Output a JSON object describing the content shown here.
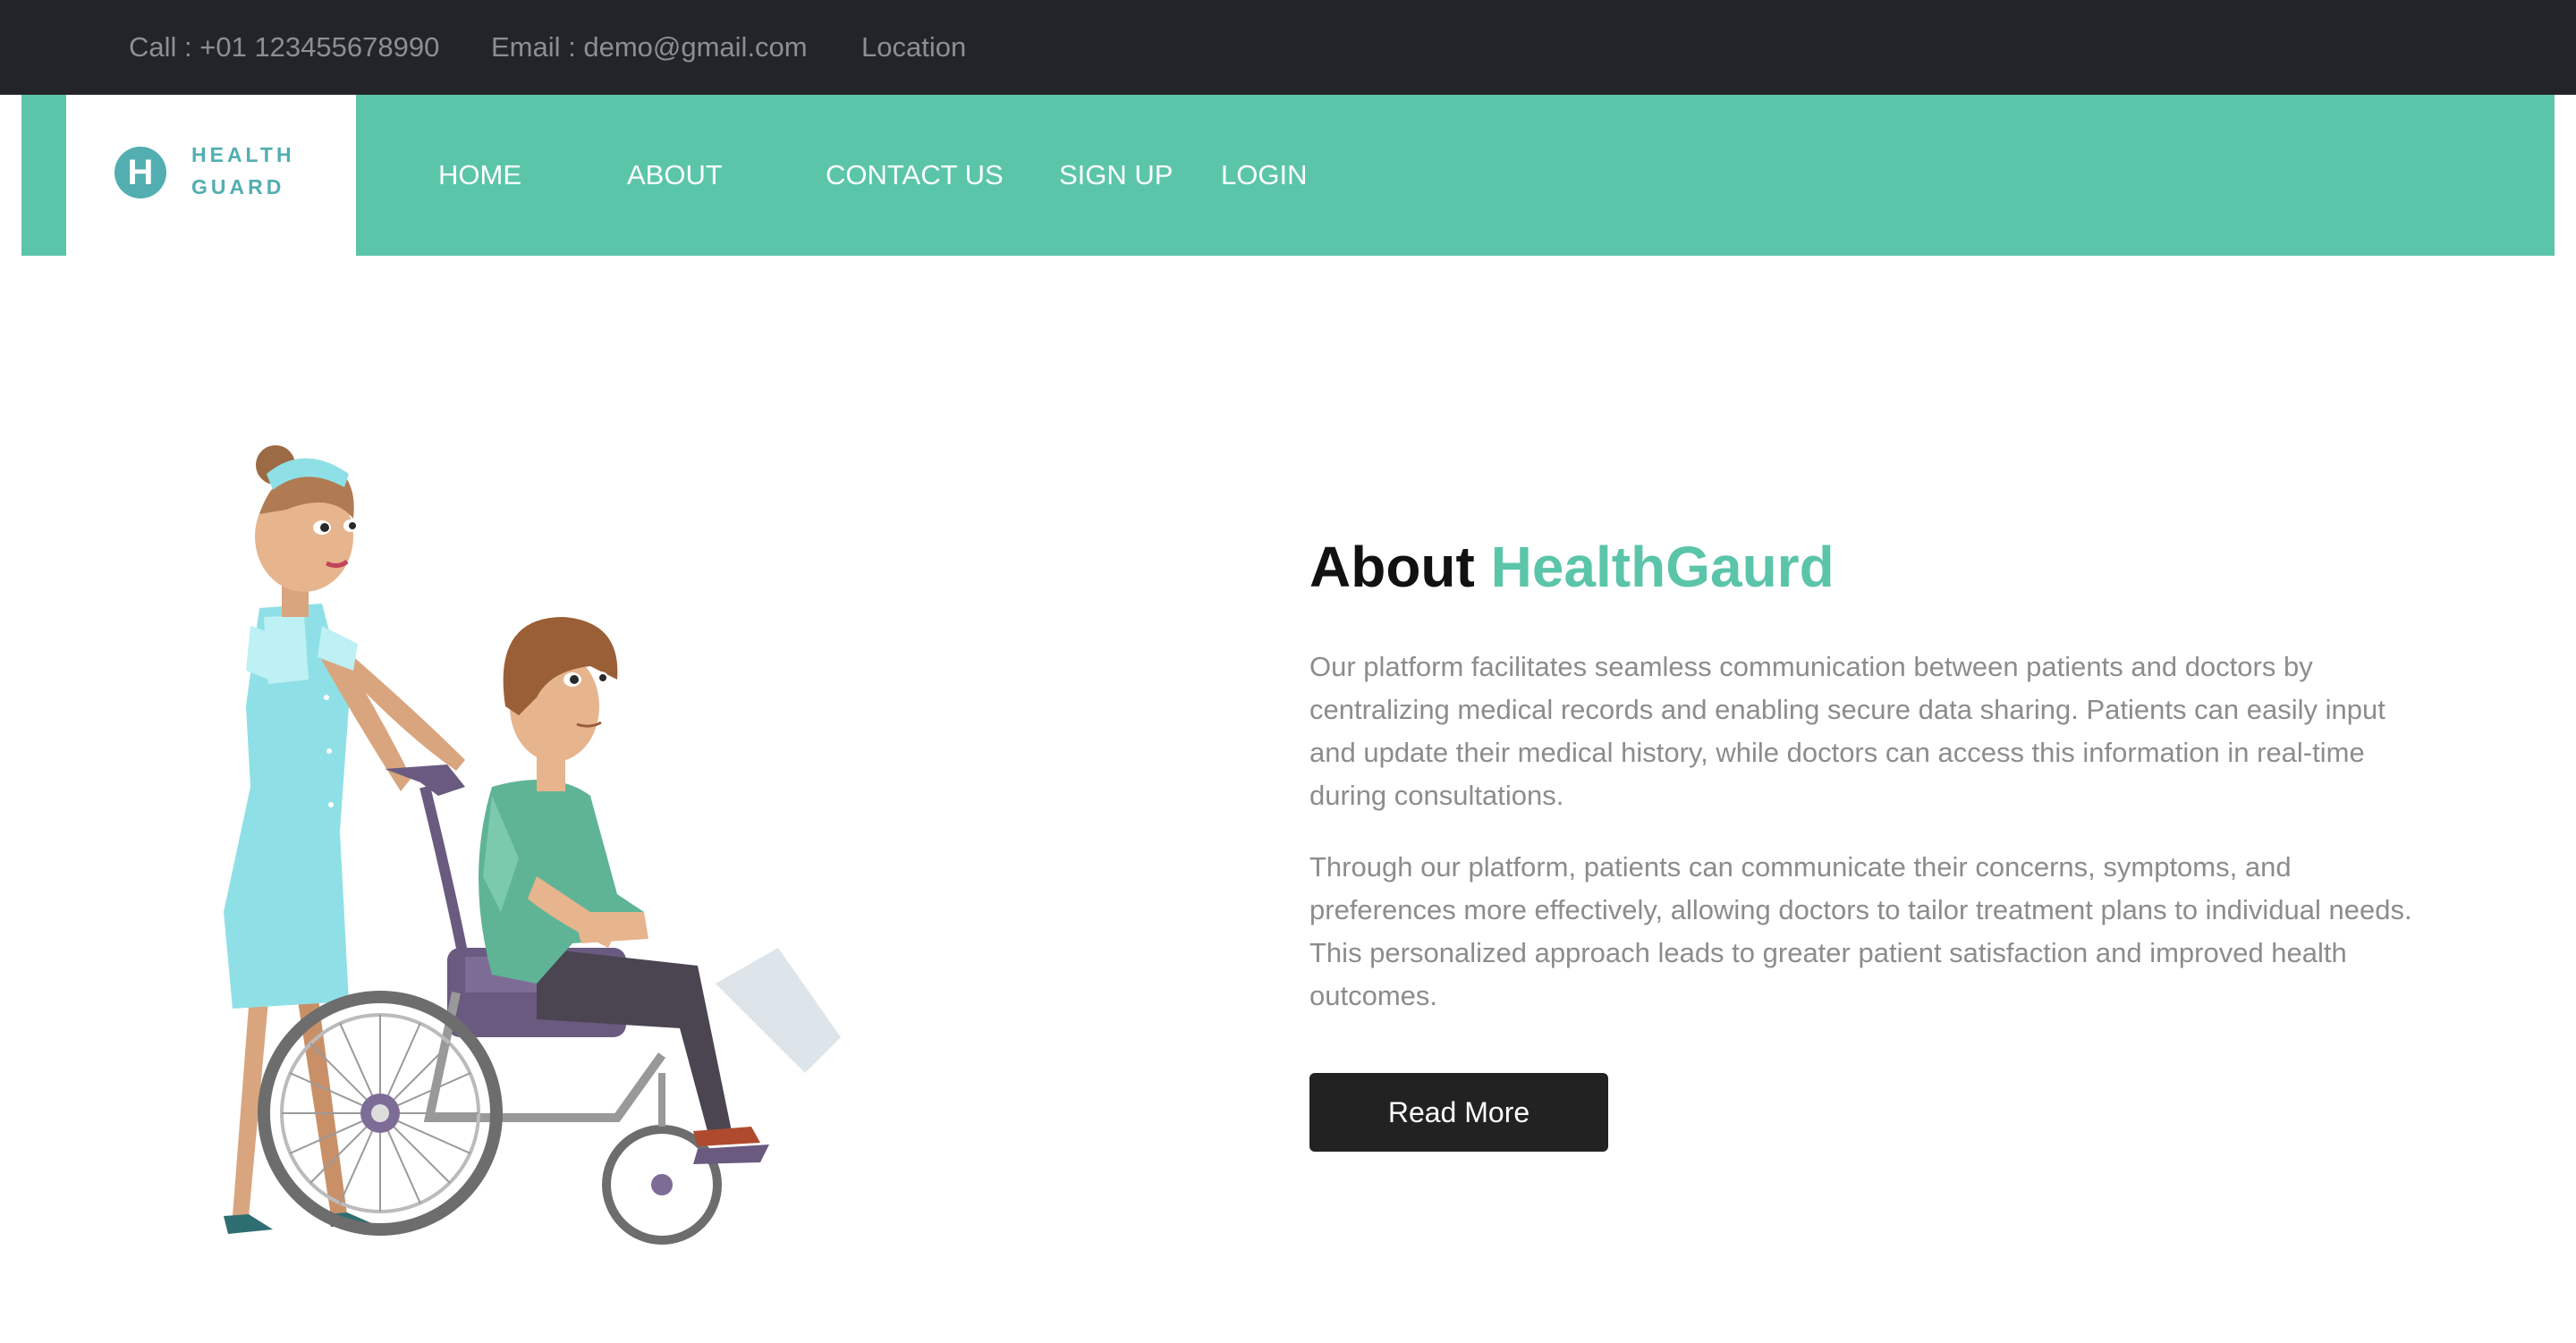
{
  "topbar": {
    "call": "Call : +01 123455678990",
    "email": "Email : demo@gmail.com",
    "location": "Location"
  },
  "logo": {
    "letter": "H",
    "line1": "HEALTH",
    "line2": "GUARD"
  },
  "nav": {
    "home": "HOME",
    "about": "ABOUT",
    "contact": "CONTACT US",
    "signup": "SIGN UP",
    "login": "LOGIN"
  },
  "about": {
    "title_prefix": "About ",
    "title_accent": "HealthGaurd",
    "paragraph1": "Our platform facilitates seamless communication between patients and doctors by centralizing medical records and enabling secure data sharing. Patients can easily input and update their medical history, while doctors can access this information in real-time during consultations.",
    "paragraph2": "Through our platform, patients can communicate their concerns, symptoms, and preferences more effectively, allowing doctors to tailor treatment plans to individual needs. This personalized approach leads to greater patient satisfaction and improved health outcomes.",
    "button": "Read More"
  },
  "colors": {
    "accent": "#5bc5a9",
    "topbar": "#222429",
    "logo": "#52aeb1",
    "button": "#222222"
  }
}
